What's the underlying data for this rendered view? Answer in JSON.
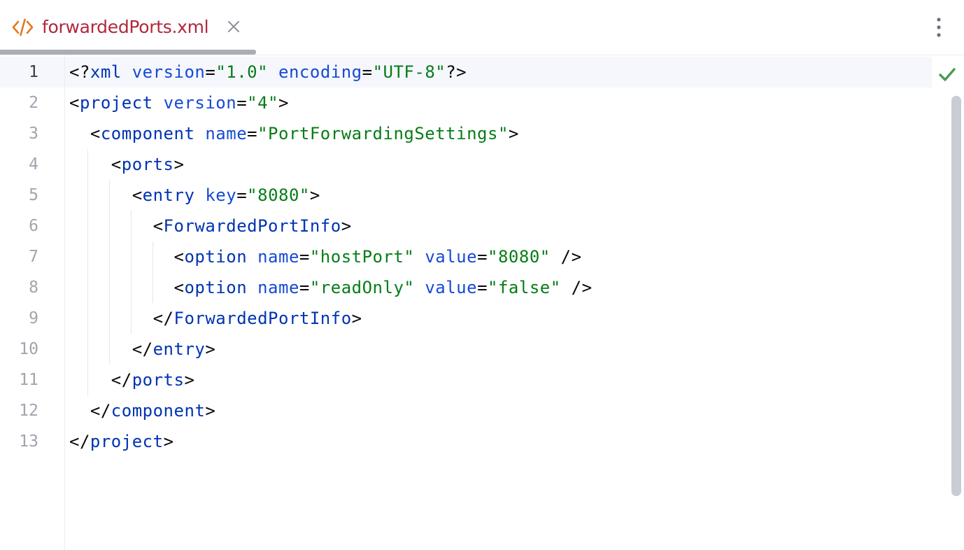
{
  "tab": {
    "title": "forwardedPorts.xml",
    "icon": "xml-file-icon",
    "close_icon": "close-icon",
    "active": true
  },
  "toolbar": {
    "more_icon": "more-vertical-icon"
  },
  "status": {
    "inspection_icon": "checkmark-icon",
    "color": "#499c54"
  },
  "colors": {
    "tab_title": "#b0283e",
    "tag": "#0033b3",
    "attribute": "#174ad4",
    "value": "#067d17",
    "line_number": "#a0a5ae"
  },
  "editor": {
    "current_line": 1,
    "lines": [
      {
        "number": "1",
        "tokens": [
          {
            "t": "<?",
            "k": "punct"
          },
          {
            "t": "xml",
            "k": "tag"
          },
          {
            "t": " ",
            "k": "punct"
          },
          {
            "t": "version",
            "k": "attr"
          },
          {
            "t": "=",
            "k": "punct"
          },
          {
            "t": "\"1.0\"",
            "k": "val"
          },
          {
            "t": " ",
            "k": "punct"
          },
          {
            "t": "encoding",
            "k": "attr"
          },
          {
            "t": "=",
            "k": "punct"
          },
          {
            "t": "\"UTF-8\"",
            "k": "val"
          },
          {
            "t": "?>",
            "k": "punct"
          }
        ]
      },
      {
        "number": "2",
        "tokens": [
          {
            "t": "<",
            "k": "punct"
          },
          {
            "t": "project",
            "k": "tag"
          },
          {
            "t": " ",
            "k": "punct"
          },
          {
            "t": "version",
            "k": "attr"
          },
          {
            "t": "=",
            "k": "punct"
          },
          {
            "t": "\"4\"",
            "k": "val"
          },
          {
            "t": ">",
            "k": "punct"
          }
        ]
      },
      {
        "number": "3",
        "tokens": [
          {
            "t": "  <",
            "k": "punct"
          },
          {
            "t": "component",
            "k": "tag"
          },
          {
            "t": " ",
            "k": "punct"
          },
          {
            "t": "name",
            "k": "attr"
          },
          {
            "t": "=",
            "k": "punct"
          },
          {
            "t": "\"PortForwardingSettings\"",
            "k": "val"
          },
          {
            "t": ">",
            "k": "punct"
          }
        ]
      },
      {
        "number": "4",
        "tokens": [
          {
            "t": "    <",
            "k": "punct"
          },
          {
            "t": "ports",
            "k": "tag"
          },
          {
            "t": ">",
            "k": "punct"
          }
        ]
      },
      {
        "number": "5",
        "tokens": [
          {
            "t": "      <",
            "k": "punct"
          },
          {
            "t": "entry",
            "k": "tag"
          },
          {
            "t": " ",
            "k": "punct"
          },
          {
            "t": "key",
            "k": "attr"
          },
          {
            "t": "=",
            "k": "punct"
          },
          {
            "t": "\"8080\"",
            "k": "val"
          },
          {
            "t": ">",
            "k": "punct"
          }
        ]
      },
      {
        "number": "6",
        "tokens": [
          {
            "t": "        <",
            "k": "punct"
          },
          {
            "t": "ForwardedPortInfo",
            "k": "tag"
          },
          {
            "t": ">",
            "k": "punct"
          }
        ]
      },
      {
        "number": "7",
        "tokens": [
          {
            "t": "          <",
            "k": "punct"
          },
          {
            "t": "option",
            "k": "tag"
          },
          {
            "t": " ",
            "k": "punct"
          },
          {
            "t": "name",
            "k": "attr"
          },
          {
            "t": "=",
            "k": "punct"
          },
          {
            "t": "\"hostPort\"",
            "k": "val"
          },
          {
            "t": " ",
            "k": "punct"
          },
          {
            "t": "value",
            "k": "attr"
          },
          {
            "t": "=",
            "k": "punct"
          },
          {
            "t": "\"8080\"",
            "k": "val"
          },
          {
            "t": " />",
            "k": "punct"
          }
        ]
      },
      {
        "number": "8",
        "tokens": [
          {
            "t": "          <",
            "k": "punct"
          },
          {
            "t": "option",
            "k": "tag"
          },
          {
            "t": " ",
            "k": "punct"
          },
          {
            "t": "name",
            "k": "attr"
          },
          {
            "t": "=",
            "k": "punct"
          },
          {
            "t": "\"readOnly\"",
            "k": "val"
          },
          {
            "t": " ",
            "k": "punct"
          },
          {
            "t": "value",
            "k": "attr"
          },
          {
            "t": "=",
            "k": "punct"
          },
          {
            "t": "\"false\"",
            "k": "val"
          },
          {
            "t": " />",
            "k": "punct"
          }
        ]
      },
      {
        "number": "9",
        "tokens": [
          {
            "t": "        </",
            "k": "punct"
          },
          {
            "t": "ForwardedPortInfo",
            "k": "tag"
          },
          {
            "t": ">",
            "k": "punct"
          }
        ]
      },
      {
        "number": "10",
        "tokens": [
          {
            "t": "      </",
            "k": "punct"
          },
          {
            "t": "entry",
            "k": "tag"
          },
          {
            "t": ">",
            "k": "punct"
          }
        ]
      },
      {
        "number": "11",
        "tokens": [
          {
            "t": "    </",
            "k": "punct"
          },
          {
            "t": "ports",
            "k": "tag"
          },
          {
            "t": ">",
            "k": "punct"
          }
        ]
      },
      {
        "number": "12",
        "tokens": [
          {
            "t": "  </",
            "k": "punct"
          },
          {
            "t": "component",
            "k": "tag"
          },
          {
            "t": ">",
            "k": "punct"
          }
        ]
      },
      {
        "number": "13",
        "tokens": [
          {
            "t": "</",
            "k": "punct"
          },
          {
            "t": "project",
            "k": "tag"
          },
          {
            "t": ">",
            "k": "punct"
          }
        ]
      }
    ]
  }
}
